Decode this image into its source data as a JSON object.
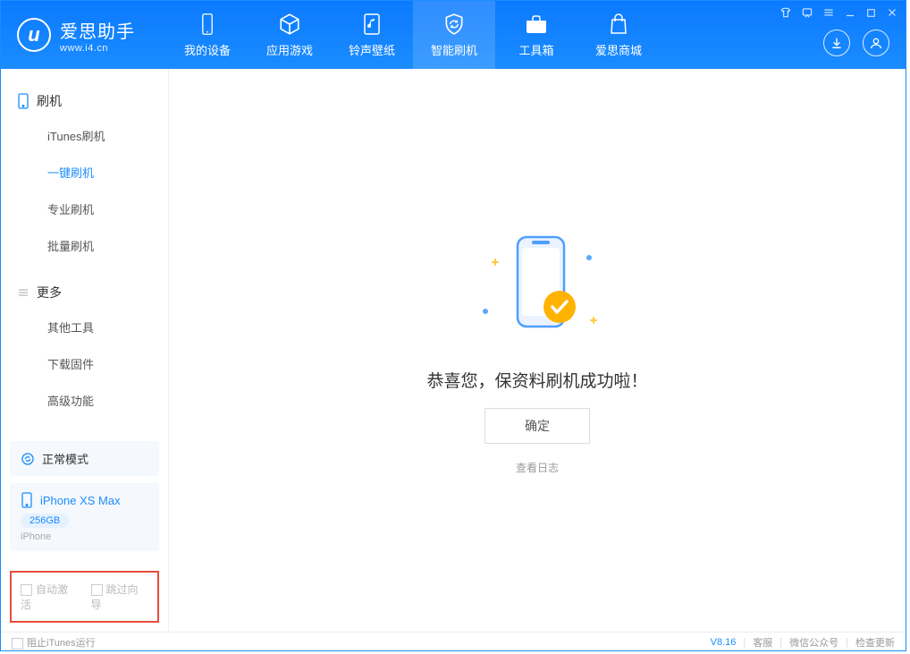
{
  "brand": {
    "name": "爱思助手",
    "domain": "www.i4.cn",
    "logo_letter": "u"
  },
  "tabs": [
    {
      "label": "我的设备"
    },
    {
      "label": "应用游戏"
    },
    {
      "label": "铃声壁纸"
    },
    {
      "label": "智能刷机"
    },
    {
      "label": "工具箱"
    },
    {
      "label": "爱思商城"
    }
  ],
  "sidebar": {
    "groups": [
      {
        "title": "刷机",
        "items": [
          "iTunes刷机",
          "一键刷机",
          "专业刷机",
          "批量刷机"
        ]
      },
      {
        "title": "更多",
        "items": [
          "其他工具",
          "下载固件",
          "高级功能"
        ]
      }
    ],
    "mode": "正常模式",
    "device": {
      "name": "iPhone XS Max",
      "storage": "256GB",
      "type": "iPhone"
    },
    "checkboxes": {
      "auto_activate": "自动激活",
      "skip_guide": "跳过向导"
    }
  },
  "main": {
    "success_msg": "恭喜您，保资料刷机成功啦！",
    "ok_btn": "确定",
    "view_log": "查看日志"
  },
  "footer": {
    "block_itunes": "阻止iTunes运行",
    "version": "V8.16",
    "links": [
      "客服",
      "微信公众号",
      "检查更新"
    ]
  }
}
